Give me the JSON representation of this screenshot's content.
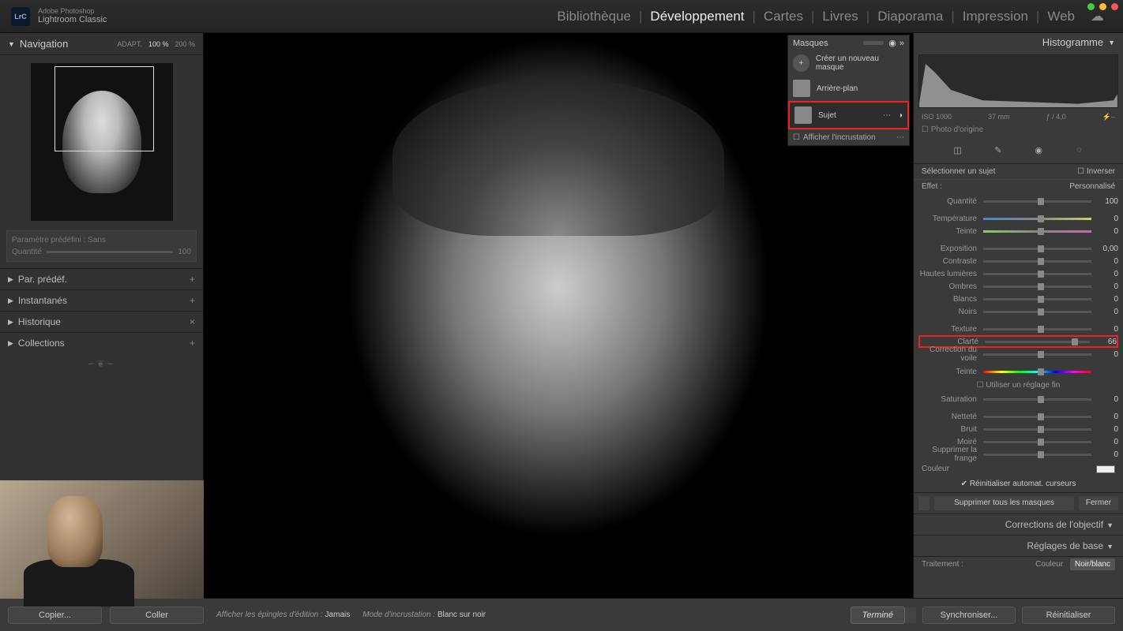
{
  "app": {
    "suite": "Adobe Photoshop",
    "name": "Lightroom Classic",
    "badge": "LrC"
  },
  "modules": {
    "items": [
      "Bibliothèque",
      "Développement",
      "Cartes",
      "Livres",
      "Diaporama",
      "Impression",
      "Web"
    ],
    "active": "Développement"
  },
  "left": {
    "navigation": {
      "title": "Navigation",
      "fit": "ADAPT.",
      "z100": "100 %",
      "z200": "200 %"
    },
    "preset_box": {
      "label": "Paramètre prédéfini : Sans",
      "amount_label": "Quantité",
      "amount_value": "100"
    },
    "panels": {
      "presets": "Par. prédéf.",
      "snapshots": "Instantanés",
      "history": "Historique",
      "collections": "Collections"
    }
  },
  "masks": {
    "title": "Masques",
    "create": "Créer un nouveau masque",
    "bg": "Arrière-plan",
    "subject": "Sujet",
    "overlay": "Afficher l'incrustation"
  },
  "right": {
    "histogram": {
      "title": "Histogramme",
      "iso": "ISO 1000",
      "focal": "37 mm",
      "aperture": "ƒ / 4,0",
      "flash": "⚡–",
      "original": "Photo d'origine"
    },
    "selectSubject": "Sélectionner un sujet",
    "invert": "Inverser",
    "effect_label": "Effet :",
    "effect_value": "Personnalisé",
    "sliders": {
      "amount": {
        "label": "Quantité",
        "value": "100",
        "pos": 50
      },
      "temp": {
        "label": "Température",
        "value": "0",
        "pos": 50
      },
      "tint": {
        "label": "Teinte",
        "value": "0",
        "pos": 50
      },
      "exposure": {
        "label": "Exposition",
        "value": "0,00",
        "pos": 50
      },
      "contrast": {
        "label": "Contraste",
        "value": "0",
        "pos": 50
      },
      "highlights": {
        "label": "Hautes lumières",
        "value": "0",
        "pos": 50
      },
      "shadows": {
        "label": "Ombres",
        "value": "0",
        "pos": 50
      },
      "whites": {
        "label": "Blancs",
        "value": "0",
        "pos": 50
      },
      "blacks": {
        "label": "Noirs",
        "value": "0",
        "pos": 50
      },
      "texture": {
        "label": "Texture",
        "value": "0",
        "pos": 50
      },
      "clarity": {
        "label": "Clarté",
        "value": "66",
        "pos": 83
      },
      "dehaze": {
        "label": "Correction du voile",
        "value": "0",
        "pos": 50
      },
      "hue": {
        "label": "Teinte",
        "value": "",
        "pos": 50
      },
      "fineadj": {
        "label": "Utiliser un réglage fin"
      },
      "saturation": {
        "label": "Saturation",
        "value": "0",
        "pos": 50
      },
      "sharpness": {
        "label": "Netteté",
        "value": "0",
        "pos": 50
      },
      "noise": {
        "label": "Bruit",
        "value": "0",
        "pos": 50
      },
      "moire": {
        "label": "Moiré",
        "value": "0",
        "pos": 50
      },
      "defringe": {
        "label": "Supprimer la frange",
        "value": "0",
        "pos": 50
      }
    },
    "color_label": "Couleur",
    "reset_auto": "Réinitialiser automat. curseurs",
    "delete_all": "Supprimer tous les masques",
    "close": "Fermer",
    "lens": "Corrections de l'objectif",
    "basic": "Réglages de base",
    "treatment": {
      "label": "Traitement :",
      "color": "Couleur",
      "bw": "Noir/blanc"
    },
    "sync": "Synchroniser...",
    "reset": "Réinitialiser"
  },
  "bottom": {
    "copy": "Copier...",
    "paste": "Coller",
    "pins": "Afficher les épingles d'édition :",
    "pins_val": "Jamais",
    "overlay_mode": "Mode d'incrustation :",
    "overlay_val": "Blanc sur noir",
    "done": "Terminé"
  }
}
